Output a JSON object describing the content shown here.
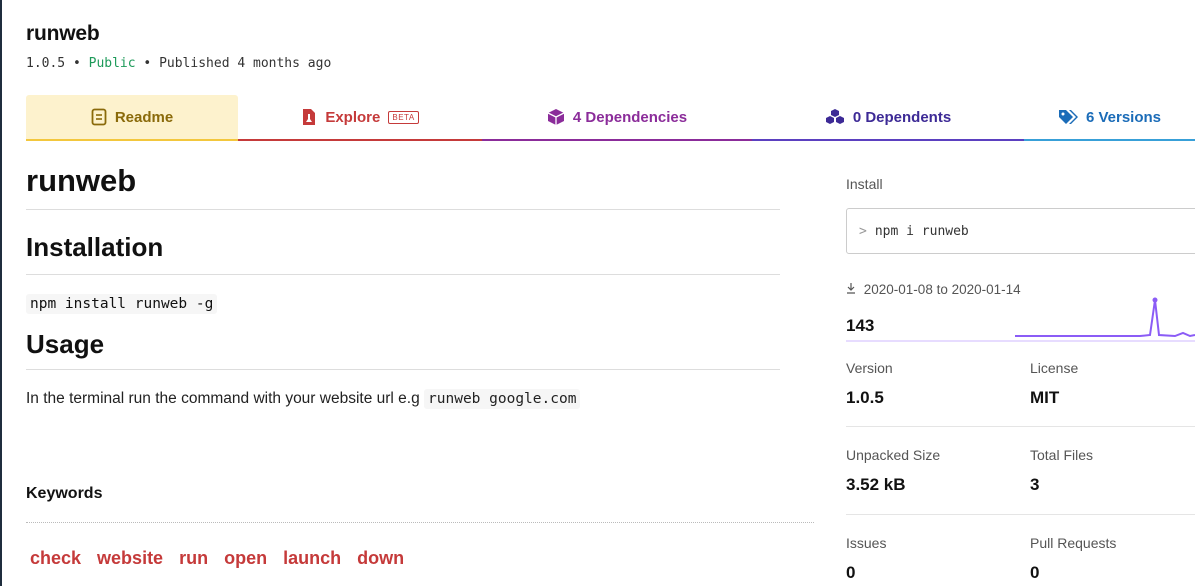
{
  "package": {
    "name": "runweb",
    "version": "1.0.5",
    "visibility": "Public",
    "published": "Published 4 months ago",
    "separator": "•"
  },
  "tabs": [
    {
      "label": "Readme",
      "icon": "readme-icon"
    },
    {
      "label": "Explore",
      "badge": "BETA",
      "icon": "explore-icon"
    },
    {
      "label": "4 Dependencies",
      "icon": "dependencies-icon"
    },
    {
      "label": "0 Dependents",
      "icon": "dependents-icon"
    },
    {
      "label": "6 Versions",
      "icon": "versions-icon"
    }
  ],
  "readme": {
    "title": "runweb",
    "installation_heading": "Installation",
    "install_command": "npm install runweb -g",
    "usage_heading": "Usage",
    "usage_text": "In the terminal run the command with your website url e.g",
    "usage_code": "runweb google.com",
    "keywords_heading": "Keywords",
    "keywords": [
      "check",
      "website",
      "run",
      "open",
      "launch",
      "down"
    ]
  },
  "sidebar": {
    "install_label": "Install",
    "install_prompt": ">",
    "install_command": "npm i runweb",
    "downloads_range": "2020-01-08 to 2020-01-14",
    "downloads_icon": "download-icon",
    "weekly_downloads": "143",
    "version_label": "Version",
    "version_value": "1.0.5",
    "license_label": "License",
    "license_value": "MIT",
    "unpacked_label": "Unpacked Size",
    "unpacked_value": "3.52 kB",
    "files_label": "Total Files",
    "files_value": "3",
    "issues_label": "Issues",
    "issues_value": "0",
    "prs_label": "Pull Requests",
    "prs_value": "0"
  },
  "colors": {
    "readme": "#f3c73d",
    "explore": "#c53a3a",
    "dependencies": "#8b2c9a",
    "dependents": "#5b40c0",
    "versions": "#38a0d8",
    "public": "#1e9a5a",
    "sparkline": "#8b5cf6"
  }
}
